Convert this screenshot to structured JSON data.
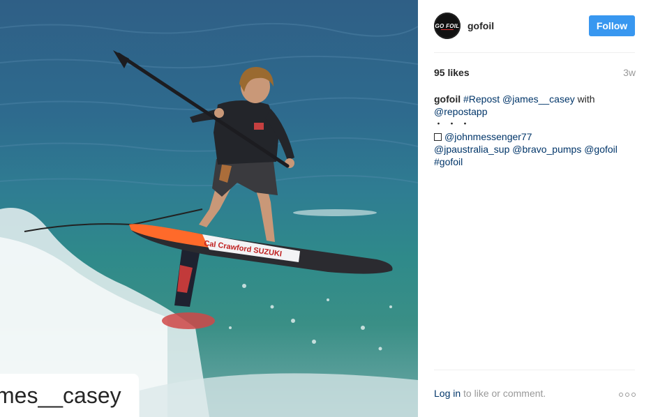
{
  "photo": {
    "alt_overlay_text": "mes__casey",
    "board_text": "Cal Crawford SUZUKI"
  },
  "header": {
    "username": "gofoil",
    "avatar_text": "GO FOIL",
    "follow_label": "Follow"
  },
  "stats": {
    "likes": "95 likes",
    "time": "3w"
  },
  "caption": {
    "author": "gofoil",
    "line1": [
      "#Repost",
      "@james__casey",
      "with"
    ],
    "line2": "@repostapp",
    "dots": "・・・",
    "mention1": "@johnmessenger77",
    "line4": [
      "@jpaustralia_sup",
      "@bravo_pumps",
      "@gofoil"
    ],
    "line5": "#gofoil"
  },
  "footer": {
    "login_label": "Log in",
    "rest": " to like or comment."
  },
  "colors": {
    "follow_bg": "#3897f0",
    "link": "#003569",
    "muted": "#999999"
  }
}
